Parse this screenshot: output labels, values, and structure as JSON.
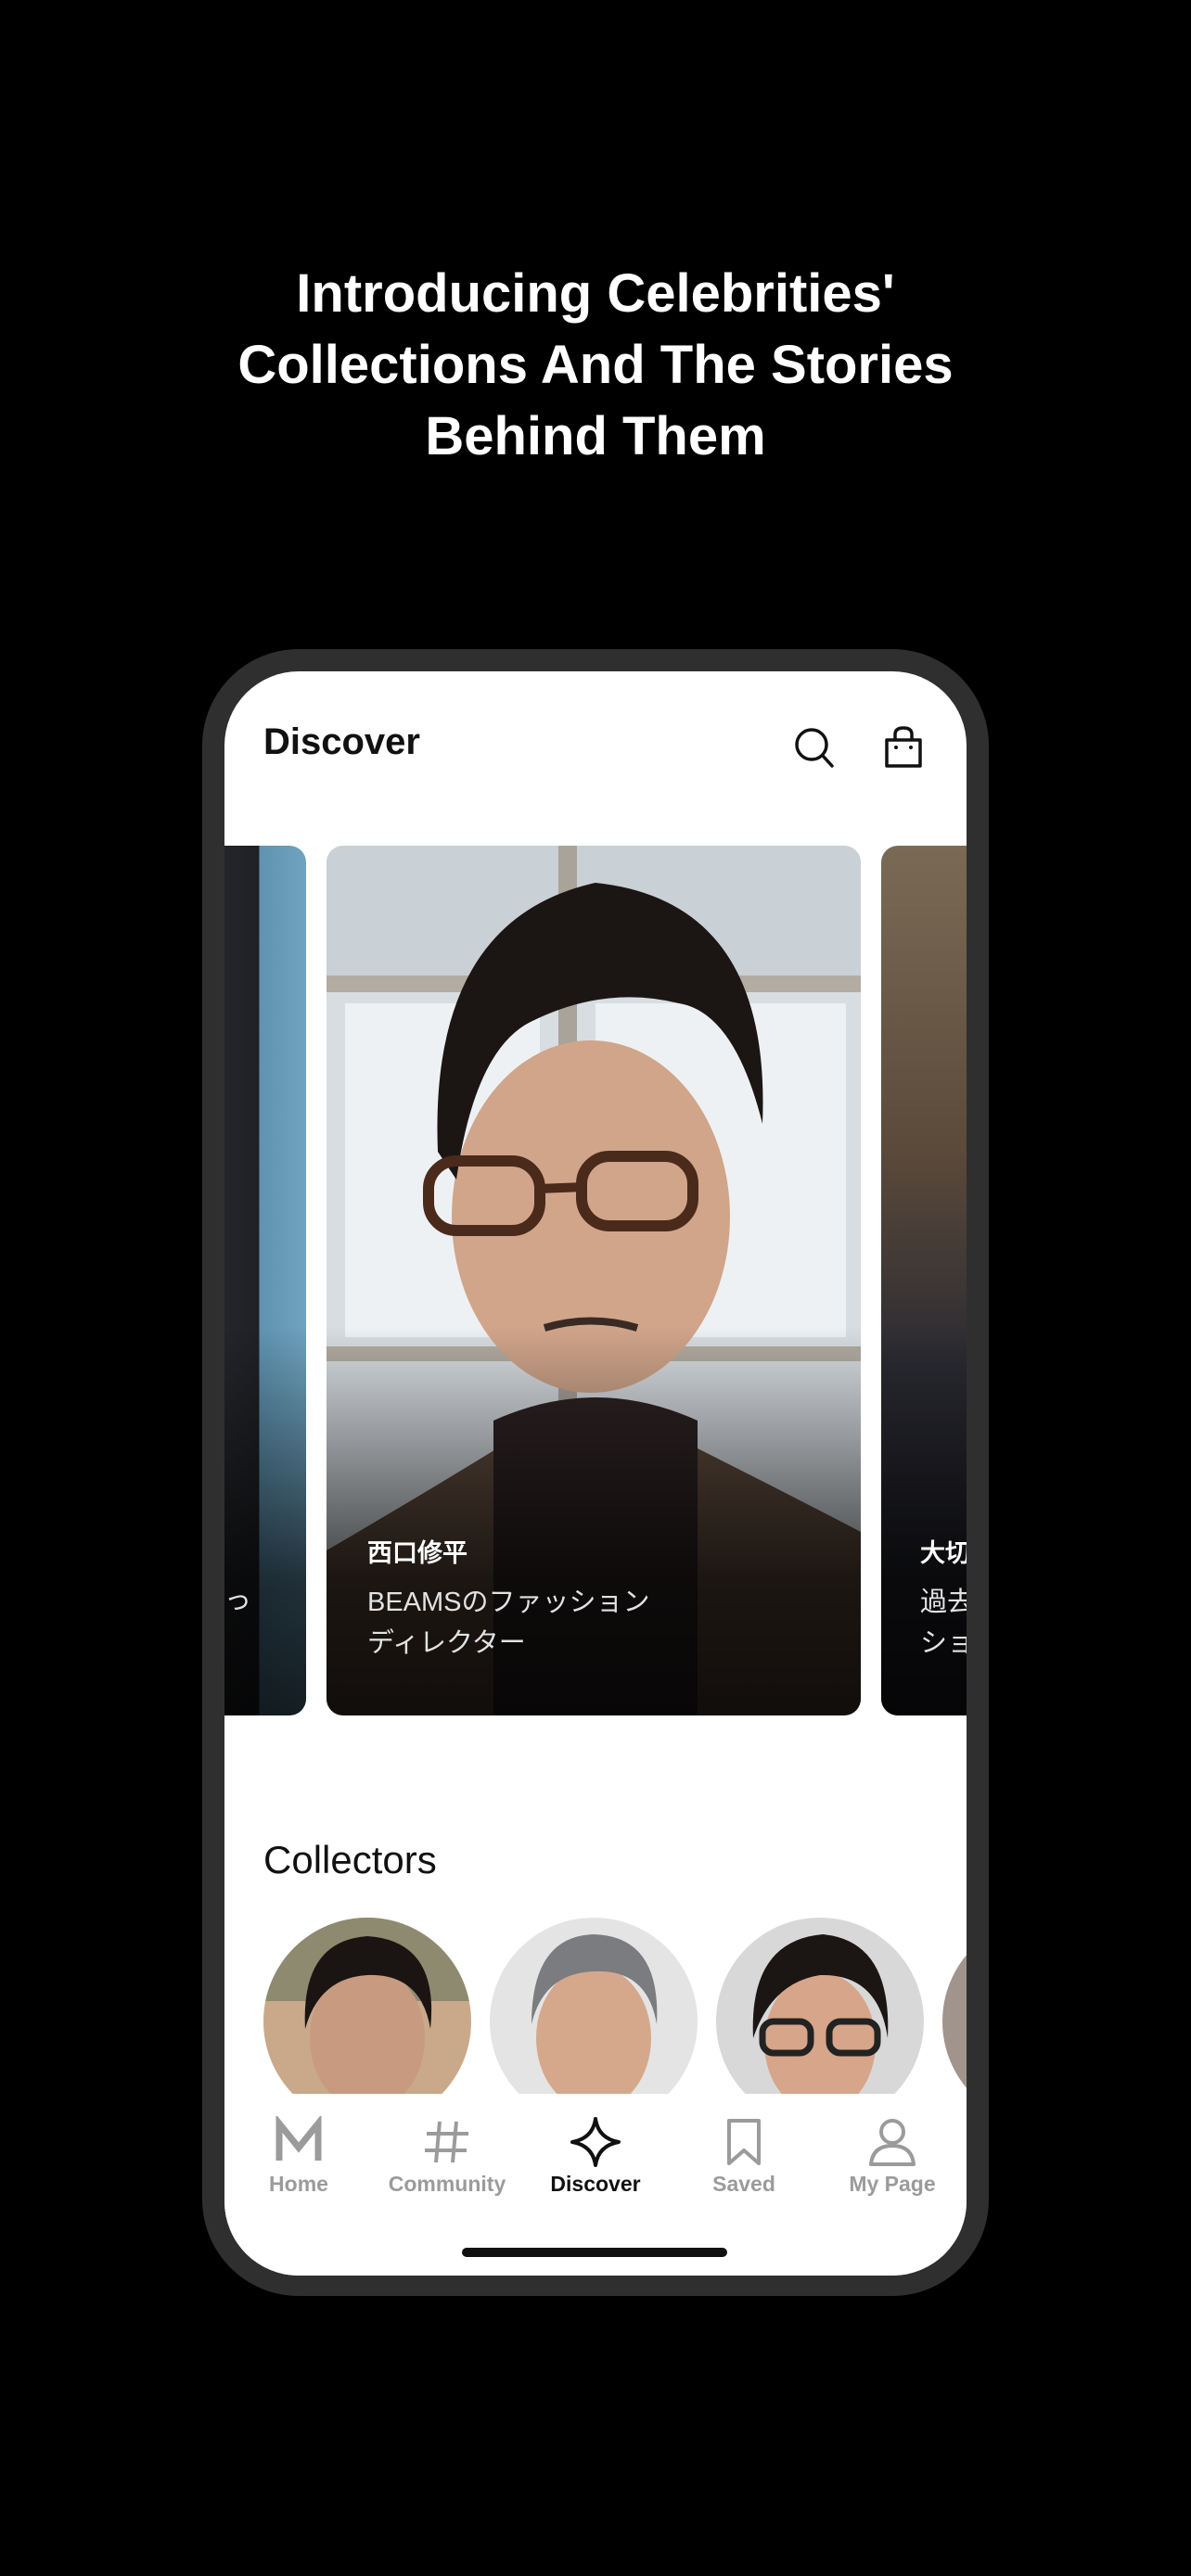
{
  "headline": {
    "line1": "Introducing Celebrities'",
    "line2": "Collections And The Stories",
    "line3": "Behind Them"
  },
  "app": {
    "title": "Discover",
    "icons": [
      "search-icon",
      "shopping-bag-icon"
    ]
  },
  "featured": {
    "left_card": {
      "desc_fragment": "っ"
    },
    "center_card": {
      "name": "西口修平",
      "desc_line1": "BEAMSのファッション",
      "desc_line2": "ディレクター"
    },
    "right_card": {
      "name_fragment": "大切",
      "desc_line1_fragment": "過去",
      "desc_line2_fragment": "ショ"
    }
  },
  "collectors": {
    "title": "Collectors"
  },
  "tabs": [
    {
      "label": "Home",
      "icon": "m-logo-icon",
      "active": false
    },
    {
      "label": "Community",
      "icon": "hash-icon",
      "active": false
    },
    {
      "label": "Discover",
      "icon": "sparkle-icon",
      "active": true
    },
    {
      "label": "Saved",
      "icon": "bookmark-icon",
      "active": false
    },
    {
      "label": "My Page",
      "icon": "person-icon",
      "active": false
    }
  ],
  "colors": {
    "background": "#000000",
    "bezel": "#2f2f2f",
    "active_tab": "#111111",
    "inactive_tab": "#9b9b9b"
  }
}
